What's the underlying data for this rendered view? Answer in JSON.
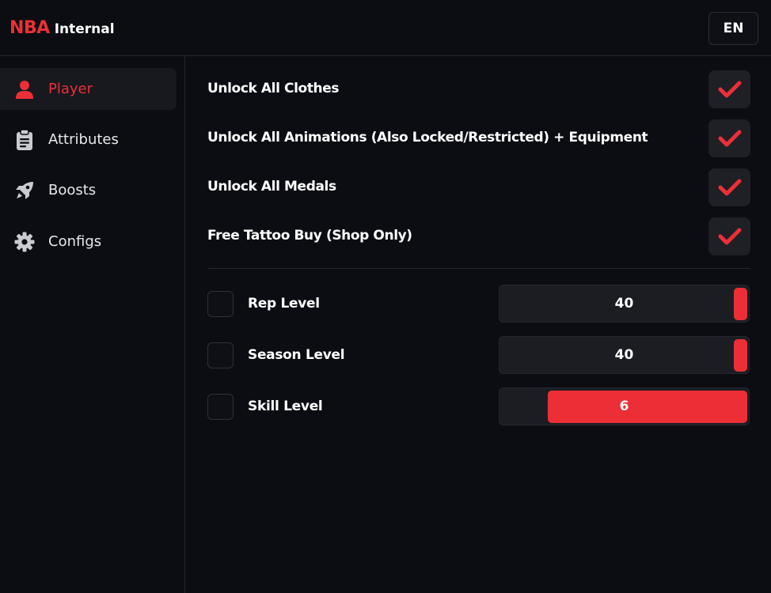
{
  "brand": {
    "accent": "NBA",
    "name": "Internal"
  },
  "language_button": "EN",
  "sidebar": {
    "items": [
      {
        "label": "Player",
        "icon": "user-icon",
        "active": true
      },
      {
        "label": "Attributes",
        "icon": "clipboard-icon",
        "active": false
      },
      {
        "label": "Boosts",
        "icon": "rocket-icon",
        "active": false
      },
      {
        "label": "Configs",
        "icon": "gear-icon",
        "active": false
      }
    ]
  },
  "options": [
    {
      "label": "Unlock All Clothes",
      "checked": true
    },
    {
      "label": "Unlock All Animations (Also Locked/Restricted) + Equipment",
      "checked": true
    },
    {
      "label": "Unlock All Medals",
      "checked": true
    },
    {
      "label": "Free Tattoo Buy (Shop Only)",
      "checked": true
    }
  ],
  "levels": [
    {
      "label": "Rep Level",
      "checked": false,
      "value": "40",
      "fill_fraction": 1.0
    },
    {
      "label": "Season Level",
      "checked": false,
      "value": "40",
      "fill_fraction": 1.0
    },
    {
      "label": "Skill Level",
      "checked": false,
      "value": "6",
      "fill_fraction": 0.2
    }
  ],
  "colors": {
    "accent": "#ec2f36",
    "background": "#0b0d12",
    "panel": "#1e2026"
  }
}
